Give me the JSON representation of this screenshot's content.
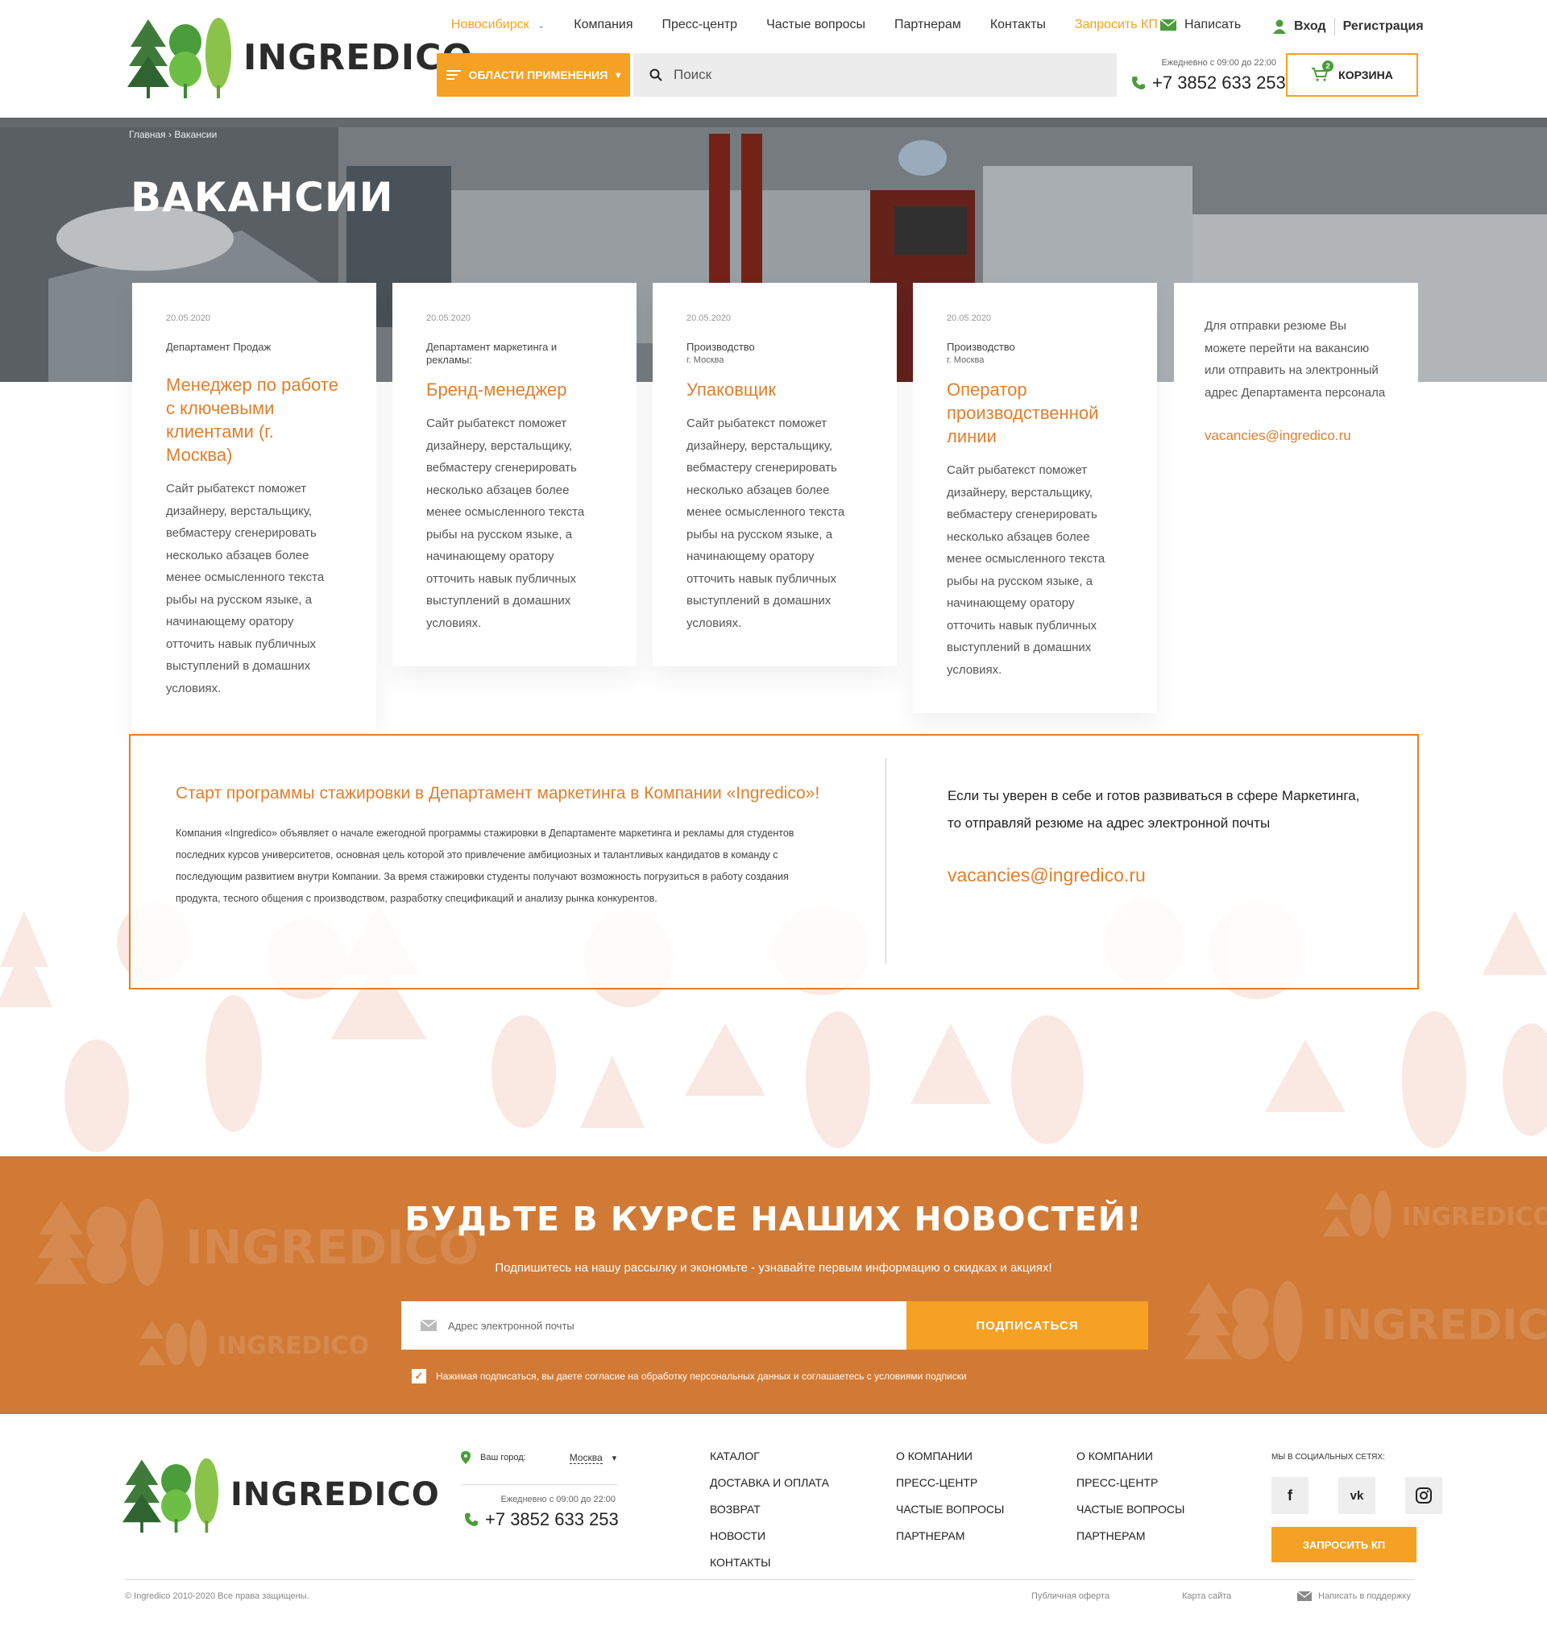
{
  "header": {
    "brand": "INGREDICO",
    "city": "Новосибирск",
    "nav": [
      "Компания",
      "Пресс-центр",
      "Частые вопросы",
      "Партнерам",
      "Контакты"
    ],
    "request_kp": "Запросить КП",
    "write": "Написать",
    "login": "Вход",
    "register": "Регистрация",
    "areas_button": "ОБЛАСТИ ПРИМЕНЕНИЯ",
    "search_placeholder": "Поиск",
    "hours": "Ежедневно с 09:00 до 22:00",
    "phone": "+7 3852 633 253",
    "cart_label": "КОРЗИНА",
    "cart_count": "2"
  },
  "hero": {
    "breadcrumb_home": "Главная",
    "breadcrumb_current": "Вакансии",
    "title": "ВАКАНСИИ"
  },
  "vacancies": [
    {
      "date": "20.05.2020",
      "dept": "Департамент Продаж",
      "city": "",
      "title": "Менеджер по работе с ключевыми клиентами (г. Москва)",
      "desc": "Сайт рыбатекст поможет дизайнеру, верстальщику, вебмастеру сгенерировать несколько абзацев более менее осмысленного текста рыбы на русском языке, а начинающему оратору отточить навык публичных выступлений в домашних условиях."
    },
    {
      "date": "20.05.2020",
      "dept": "Департамент маркетинга и рекламы:",
      "city": "",
      "title": "Бренд-менеджер",
      "desc": "Сайт рыбатекст поможет дизайнеру, верстальщику, вебмастеру сгенерировать несколько абзацев более менее осмысленного текста рыбы на русском языке, а начинающему оратору отточить навык публичных выступлений в домашних условиях."
    },
    {
      "date": "20.05.2020",
      "dept": "Производство",
      "city": "г. Москва",
      "title": "Упаковщик",
      "desc": "Сайт рыбатекст поможет дизайнеру, верстальщику, вебмастеру сгенерировать несколько абзацев более менее осмысленного текста рыбы на русском языке, а начинающему оратору отточить навык публичных выступлений в домашних условиях."
    },
    {
      "date": "20.05.2020",
      "dept": "Производство",
      "city": "г. Москва",
      "title": "Оператор производственной линии",
      "desc": "Сайт рыбатекст поможет дизайнеру, верстальщику, вебмастеру сгенерировать несколько абзацев более менее осмысленного текста рыбы на русском языке, а начинающему оратору отточить навык публичных выступлений в домашних условиях."
    }
  ],
  "resume_info": {
    "text": "Для отправки резюме Вы можете перейти на вакансию или отправить на электронный адрес Департамента персонала",
    "email": "vacancies@ingredico.ru"
  },
  "internship": {
    "title": "Старт программы стажировки в Департамент маркетинга в Компании «Ingredico»!",
    "text": "Компания «Ingredico» объявляет о начале ежегодной программы стажировки в Департаменте маркетинга и рекламы для студентов последних курсов университетов, основная цель которой это привлечение амбициозных и талантливых кандидатов в команду с последующим развитием внутри Компании. За время стажировки студенты получают возможность погрузиться в работу создания продукта, тесного общения с производством, разработку спецификаций и анализу рынка конкурентов.",
    "right_text": "Если ты уверен в себе и готов развиваться в сфере Маркетинга, то отправляй резюме на адрес электронной почты",
    "email": "vacancies@ingredico.ru"
  },
  "newsletter": {
    "title": "БУДЬТЕ В КУРСЕ НАШИХ НОВОСТЕЙ!",
    "subtitle": "Подпишитесь на нашу рассылку и экономьте - узнавайте первым информацию о скидках и акциях!",
    "placeholder": "Адрес электронной почты",
    "button": "ПОДПИСАТЬСЯ",
    "consent": "Нажимая подписаться, вы даете согласие на обработку персональных данных и соглашаетесь с условиями подписки"
  },
  "footer": {
    "brand": "INGREDICO",
    "city_label": "Ваш город:",
    "city": "Москва",
    "hours": "Ежедневно с 09:00 до 22:00",
    "phone": "+7 3852 633 253",
    "col1": [
      "КАТАЛОГ",
      "ДОСТАВКА И ОПЛАТА",
      "ВОЗВРАТ",
      "НОВОСТИ",
      "КОНТАКТЫ"
    ],
    "col2": [
      "О КОМПАНИИ",
      "ПРЕСС-ЦЕНТР",
      "ЧАСТЫЕ ВОПРОСЫ",
      "ПАРТНЕРАМ"
    ],
    "col3": [
      "О КОМПАНИИ",
      "ПРЕСС-ЦЕНТР",
      "ЧАСТЫЕ ВОПРОСЫ",
      "ПАРТНЕРАМ"
    ],
    "social_label": "МЫ В СОЦИАЛЬНЫХ СЕТЯХ:",
    "social": [
      "facebook-icon",
      "vk-icon",
      "instagram-icon"
    ],
    "request_kp": "ЗАПРОСИТЬ КП",
    "copyright": "© Ingredico 2010-2020 Все права защищены.",
    "offer": "Публичная оферта",
    "sitemap": "Карта сайта",
    "support": "Написать в поддержку"
  },
  "colors": {
    "accent": "#f5a123",
    "accent_dark": "#e07f2c",
    "newsletter_bg": "#d17a36",
    "green": "#4a9d3a"
  }
}
